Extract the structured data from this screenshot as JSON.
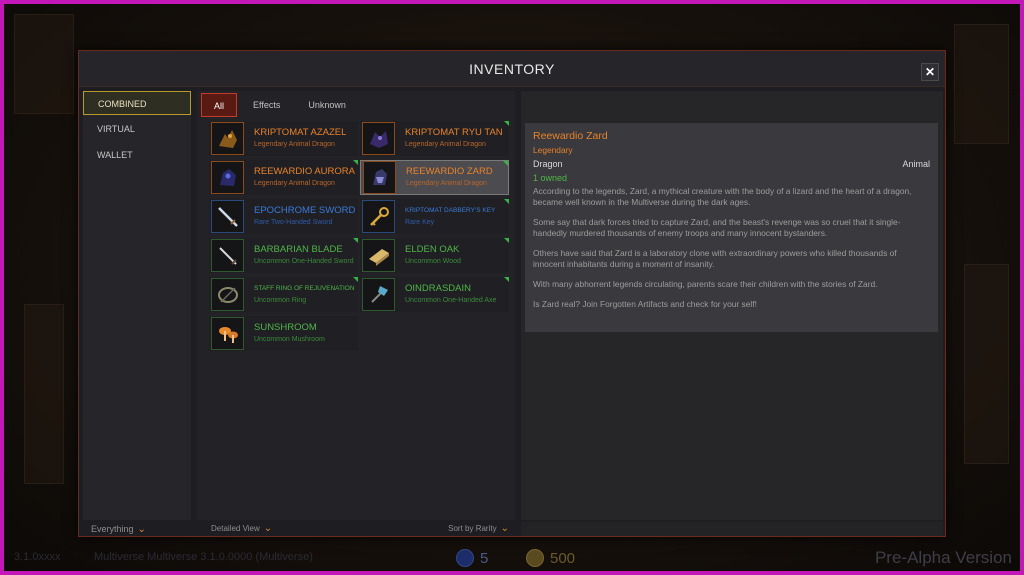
{
  "window": {
    "title": "INVENTORY",
    "close_label": "✕"
  },
  "sidebar": {
    "items": [
      {
        "label": "COMBINED",
        "active": true
      },
      {
        "label": "VIRTUAL",
        "active": false
      },
      {
        "label": "WALLET",
        "active": false
      }
    ],
    "footer_label": "Everything"
  },
  "tabs": [
    {
      "label": "All",
      "active": true
    },
    {
      "label": "Effects",
      "active": false
    },
    {
      "label": "Unknown",
      "active": false
    }
  ],
  "items": [
    {
      "name": "KRIPTOMAT AZAZEL",
      "subtitle": "Legendary Animal Dragon",
      "rarity": "legendary",
      "icon": "dragon-icon"
    },
    {
      "name": "KRIPTOMAT RYU TAN",
      "subtitle": "Legendary Animal Dragon",
      "rarity": "legendary",
      "icon": "dragon-icon"
    },
    {
      "name": "REEWARDIO AURORA",
      "subtitle": "Legendary Animal Dragon",
      "rarity": "legendary",
      "icon": "dragon-icon"
    },
    {
      "name": "REEWARDIO ZARD",
      "subtitle": "Legendary Animal Dragon",
      "rarity": "legendary",
      "icon": "dragon-icon",
      "selected": true
    },
    {
      "name": "EPOCHROME SWORD",
      "subtitle": "Rare Two-Handed Sword",
      "rarity": "rare",
      "icon": "sword-icon"
    },
    {
      "name": "KRIPTOMAT DABBERY'S KEY",
      "subtitle": "Rare Key",
      "rarity": "rare",
      "icon": "key-icon",
      "small": true
    },
    {
      "name": "BARBARIAN BLADE",
      "subtitle": "Uncommon One-Handed Sword",
      "rarity": "uncommon",
      "icon": "blade-icon"
    },
    {
      "name": "ELDEN OAK",
      "subtitle": "Uncommon Wood",
      "rarity": "uncommon",
      "icon": "wood-plank-icon"
    },
    {
      "name": "STAFF RING OF REJUVENATION",
      "subtitle": "Uncommon Ring",
      "rarity": "uncommon",
      "icon": "ring-icon",
      "small": true
    },
    {
      "name": "OINDRASDAIN",
      "subtitle": "Uncommon One-Handed Axe",
      "rarity": "uncommon",
      "icon": "axe-icon"
    },
    {
      "name": "SUNSHROOM",
      "subtitle": "Uncommon Mushroom",
      "rarity": "uncommon",
      "icon": "mushroom-icon"
    }
  ],
  "footer": {
    "view_label": "Detailed View",
    "sort_label": "Sort by Rarity"
  },
  "detail": {
    "title": "Reewardio Zard",
    "rarity": "Legendary",
    "type_left": "Dragon",
    "type_right": "Animal",
    "owned": "1 owned",
    "paragraphs": [
      "According to the legends, Zard, a mythical creature with the body of a lizard and the heart of a dragon, became well known in the Multiverse during the dark ages.",
      "Some say that dark forces tried to capture Zard, and the beast's revenge was so cruel that it single-handedly murdered thousands of enemy troops and many innocent bystanders.",
      "Others have said that Zard is a laboratory clone with extraordinary powers who killed thousands of innocent inhabitants during a moment of insanity.",
      "With many abhorrent legends circulating, parents scare their children with the stories of Zard.",
      "Is Zard real? Join Forgotten Artifacts and check for your self!"
    ]
  },
  "hud": {
    "left_text": "3.1.0xxxx",
    "mid_text": "Multiverse Multiverse 3.1.0.0000 (Multiverse)",
    "gems": "5",
    "coins": "500",
    "version": "Pre-Alpha Version"
  },
  "colors": {
    "frame": "#c417b8",
    "legendary": "#e8822a",
    "rare": "#3a7ad8",
    "uncommon": "#4fb548",
    "accent_red": "#c23a2a"
  }
}
